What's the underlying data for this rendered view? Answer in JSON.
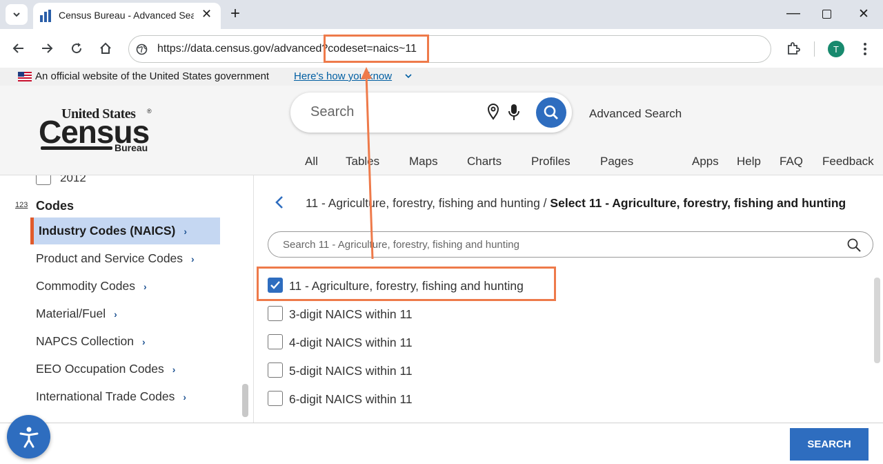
{
  "browser": {
    "tab_title": "Census Bureau - Advanced Sear",
    "url_prefix": "https://data.census.gov/advanced",
    "url_query": "?codeset=naics~11",
    "profile_initial": "T"
  },
  "banner": {
    "text": "An official website of the United States government",
    "link": "Here's how you know"
  },
  "logo": {
    "line1": "United States",
    "line2": "Census",
    "line3": "Bureau"
  },
  "search": {
    "placeholder": "Search",
    "advanced_label": "Advanced Search"
  },
  "nav": {
    "tabs": [
      "All",
      "Tables",
      "Maps",
      "Charts",
      "Profiles",
      "Pages"
    ],
    "links": [
      "Apps",
      "Help",
      "FAQ",
      "Feedback"
    ]
  },
  "sidebar": {
    "year_item": "2012",
    "codes_badge": "123",
    "codes_heading": "Codes",
    "items": [
      "Industry Codes (NAICS)",
      "Product and Service Codes",
      "Commodity Codes",
      "Material/Fuel",
      "NAPCS Collection",
      "EEO Occupation Codes",
      "International Trade Codes"
    ]
  },
  "main": {
    "breadcrumb_plain": "11 - Agriculture, forestry, fishing and hunting /",
    "breadcrumb_bold": "Select 11 - Agriculture, forestry, fishing and hunting",
    "filter_placeholder": "Search 11 - Agriculture, forestry, fishing and hunting",
    "options": [
      {
        "label": "11 - Agriculture, forestry, fishing and hunting",
        "checked": true
      },
      {
        "label": "3-digit NAICS within 11",
        "checked": false
      },
      {
        "label": "4-digit NAICS within 11",
        "checked": false
      },
      {
        "label": "5-digit NAICS within 11",
        "checked": false
      },
      {
        "label": "6-digit NAICS within 11",
        "checked": false
      }
    ]
  },
  "footer": {
    "search_button": "SEARCH"
  },
  "colors": {
    "accent": "#2e6dbf",
    "highlight": "#ee7a4a",
    "selected_bg": "#c5d7f2",
    "selected_bar": "#e05a2b"
  }
}
